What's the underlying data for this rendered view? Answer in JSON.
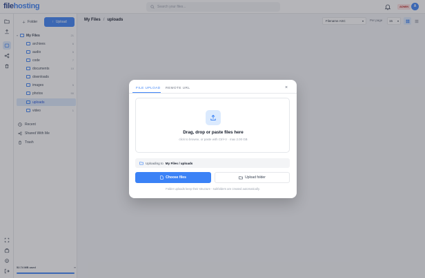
{
  "app": {
    "logo_main": "file",
    "logo_accent": "hosting",
    "search_placeholder": "Search your files...",
    "notification_badge": "ADMIN",
    "avatar_initial": "A"
  },
  "sidebar": {
    "folder_button": "Folder",
    "upload_button": "Upload",
    "root": {
      "label": "My Files",
      "count": "21"
    },
    "folders": [
      {
        "label": "archives",
        "count": "6"
      },
      {
        "label": "audio",
        "count": "5"
      },
      {
        "label": "code",
        "count": "7"
      },
      {
        "label": "documents",
        "count": "10"
      },
      {
        "label": "downloads",
        "count": ""
      },
      {
        "label": "images",
        "count": "5"
      },
      {
        "label": "photos",
        "count": "90"
      },
      {
        "label": "uploads",
        "count": ""
      },
      {
        "label": "video",
        "count": "1"
      }
    ],
    "nav": [
      {
        "label": "Recent",
        "icon": "clock-icon"
      },
      {
        "label": "Shared With Me",
        "icon": "share-icon"
      },
      {
        "label": "Trash",
        "icon": "trash-icon"
      }
    ],
    "storage_used": "52.74 MB used",
    "storage_pct_text": "∞",
    "storage_fraction": 1.0
  },
  "toolbar": {
    "breadcrumb_root": "My Files",
    "breadcrumb_sep": "/",
    "breadcrumb_current": "uploads",
    "sort_value": "Filename ASC",
    "per_page_label": "Per page",
    "per_page_value": "15"
  },
  "modal": {
    "tab_upload": "FILE UPLOAD",
    "tab_remote": "REMOTE URL",
    "close": "×",
    "drop_title": "Drag, drop or paste files here",
    "drop_sub": "click to browse, or paste with Ctrl+V · max 2.00 GB",
    "target_prefix": "Uploading to",
    "target_path": "My Files / uploads",
    "choose_files": "Choose files",
    "upload_folder": "Upload folder",
    "hint": "Folder uploads keep their structure - subfolders are created automatically."
  },
  "colors": {
    "accent": "#3b82f6",
    "brand": "#1e3a8a"
  }
}
